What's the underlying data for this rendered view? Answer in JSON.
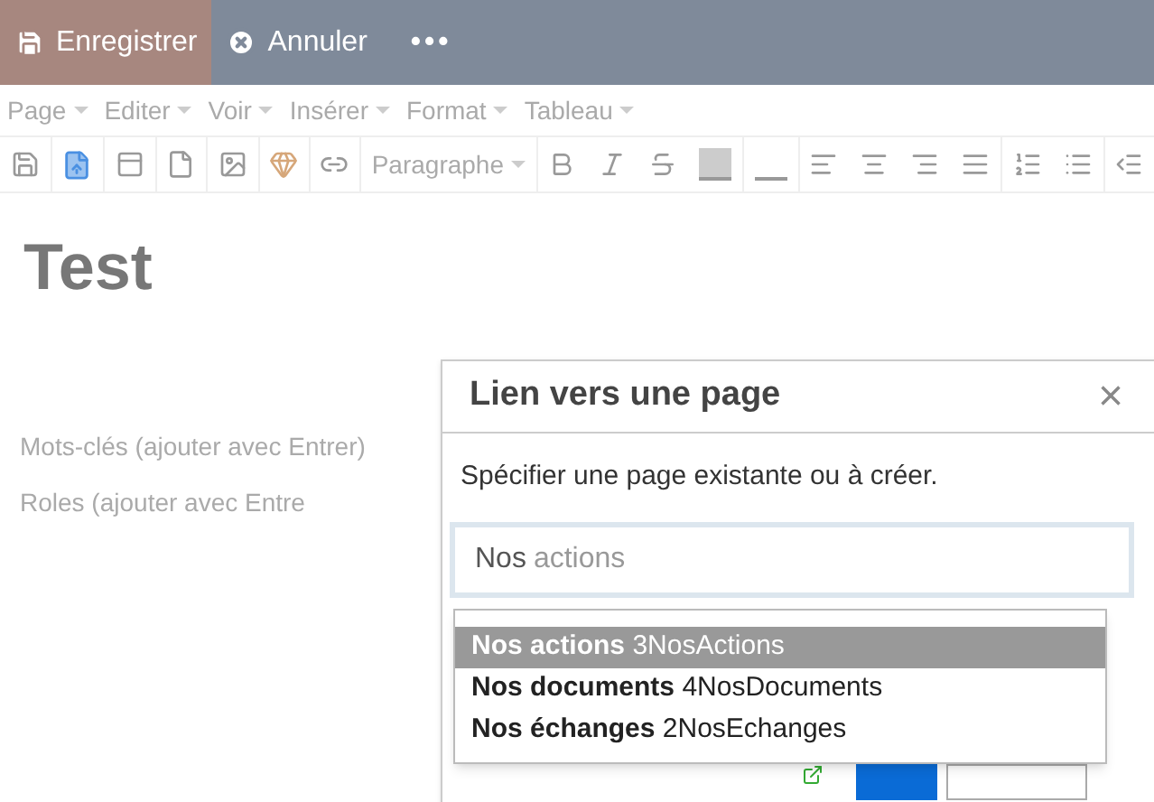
{
  "top_bar": {
    "buttons": [
      {
        "kind": "save",
        "label": "Enregistrer",
        "selected": true
      },
      {
        "kind": "cancel",
        "label": "Annuler",
        "selected": false
      },
      {
        "kind": "more",
        "label": "•••",
        "selected": false
      }
    ]
  },
  "menu_bar": [
    "Page",
    "Editer",
    "Voir",
    "Insérer",
    "Format",
    "Tableau"
  ],
  "toolbar": {
    "format_select": "Paragraphe"
  },
  "editor": {
    "title": "Test",
    "fields": [
      {
        "placeholder": "Mots-clés (ajouter avec Entrer)"
      },
      {
        "placeholder": "Roles (ajouter avec Entre"
      }
    ]
  },
  "dialog": {
    "title": "Lien vers une page",
    "close": "×",
    "instruction": "Spécifier une page existante ou à créer.",
    "input": {
      "value": "Nos",
      "suggestion": "actions"
    },
    "suggestions": [
      {
        "name": "Nos actions",
        "slug": "3NosActions",
        "selected": true
      },
      {
        "name": "Nos documents",
        "slug": "4NosDocuments",
        "selected": false
      },
      {
        "name": "Nos échanges",
        "slug": "2NosEchanges",
        "selected": false
      }
    ]
  }
}
